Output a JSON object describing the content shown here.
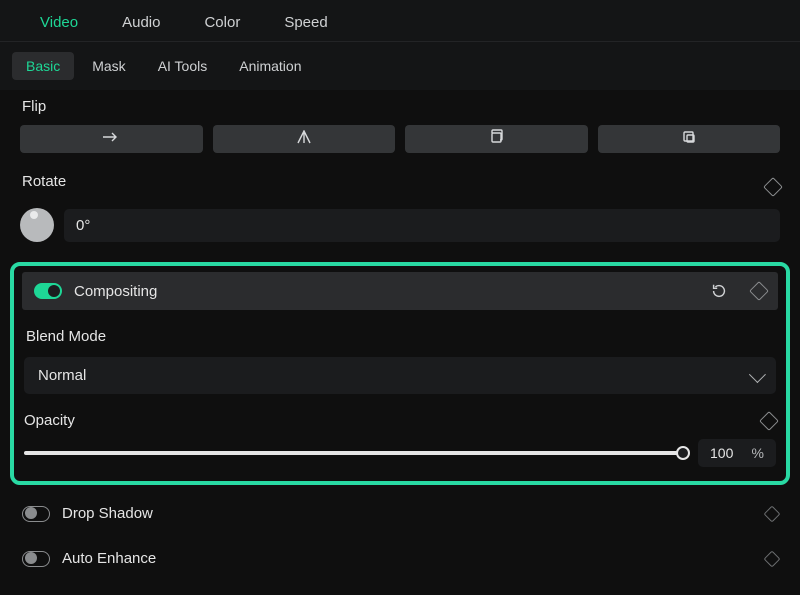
{
  "tabs": {
    "video": "Video",
    "audio": "Audio",
    "color": "Color",
    "speed": "Speed"
  },
  "subtabs": {
    "basic": "Basic",
    "mask": "Mask",
    "aitools": "AI Tools",
    "animation": "Animation"
  },
  "flip": {
    "label": "Flip"
  },
  "rotate": {
    "label": "Rotate",
    "value": "0°"
  },
  "compositing": {
    "label": "Compositing",
    "blend_label": "Blend Mode",
    "blend_value": "Normal",
    "opacity_label": "Opacity",
    "opacity_value": "100",
    "opacity_unit": "%"
  },
  "drop_shadow": {
    "label": "Drop Shadow"
  },
  "auto_enhance": {
    "label": "Auto Enhance"
  }
}
